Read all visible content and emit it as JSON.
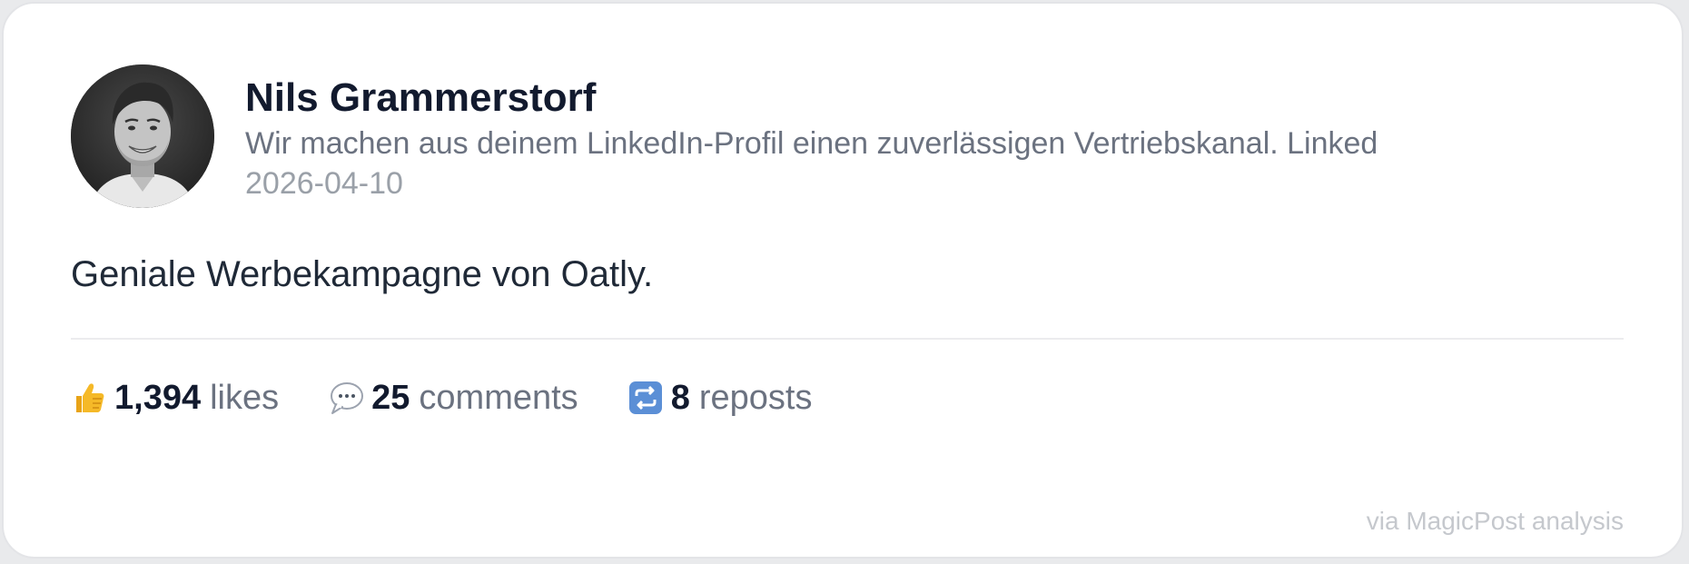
{
  "author": {
    "name": "Nils Grammerstorf",
    "headline": "Wir machen aus deinem LinkedIn-Profil einen zuverlässigen Vertriebskanal. Linked",
    "date": "2026-04-10",
    "avatar_icon": "person-photo"
  },
  "post": {
    "text": "Geniale Werbekampagne von Oatly."
  },
  "stats": {
    "likes": {
      "icon": "thumbs-up-icon",
      "count": "1,394",
      "label": "likes"
    },
    "comments": {
      "icon": "speech-bubble-icon",
      "count": "25",
      "label": "comments"
    },
    "reposts": {
      "icon": "repost-icon",
      "count": "8",
      "label": "reposts"
    }
  },
  "footer": {
    "text": "via MagicPost analysis"
  },
  "colors": {
    "name": "#121a2e",
    "muted": "#6b7280",
    "date": "#9aa0a8",
    "repost_badge": "#5b8fd6",
    "thumb": "#f5b928"
  }
}
